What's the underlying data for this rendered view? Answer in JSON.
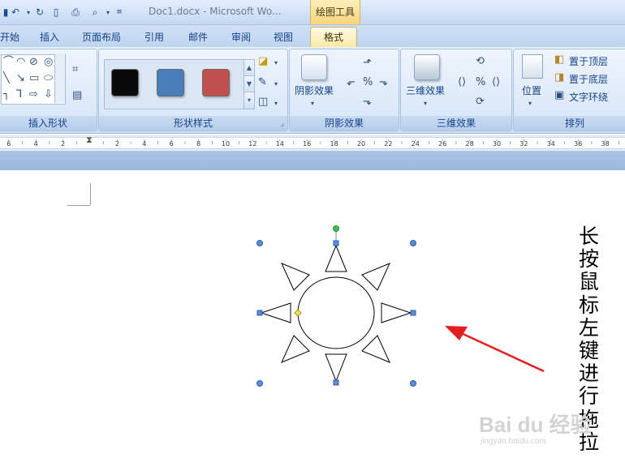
{
  "window": {
    "doc_title": "Doc1.docx - Microsoft Wo...",
    "contextual_group": "绘图工具"
  },
  "tabs": [
    "开始",
    "插入",
    "页面布局",
    "引用",
    "邮件",
    "审阅",
    "视图",
    "格式"
  ],
  "ribbon": {
    "insert_shapes_label": "插入形状",
    "shape_styles_label": "形状样式",
    "shadow_effects_label": "阴影效果",
    "shadow_effects_button": "阴影效果",
    "3d_effects_label": "三维效果",
    "3d_effects_button": "三维效果",
    "arrange_label": "排列",
    "position_button": "位置",
    "bring_to_front": "置于顶层",
    "send_to_back": "置于底层",
    "text_wrapping": "文字环绕",
    "style_swatches": [
      "#0a0a0a",
      "#4a7ebb",
      "#c0504d"
    ]
  },
  "ruler": {
    "left_labels": [
      "6",
      "4",
      "2"
    ],
    "right_labels": [
      "2",
      "4",
      "6",
      "8",
      "10",
      "12",
      "14",
      "16",
      "18",
      "20",
      "22",
      "24",
      "26",
      "28",
      "30",
      "32",
      "34",
      "36",
      "38"
    ]
  },
  "document": {
    "instruction": "长按鼠标左键进行拖拉"
  },
  "watermark": {
    "main": "Bai du 经验",
    "sub": "jingyan.baidu.com"
  },
  "colors": {
    "ribbon_blue": "#15428b",
    "contextual_tab": "#fde8a3",
    "annotation_arrow": "#e31e1e",
    "handle_fill": "#5b8ed6",
    "rotation_handle": "#3cc24a",
    "adjust_handle": "#ffe34f"
  }
}
